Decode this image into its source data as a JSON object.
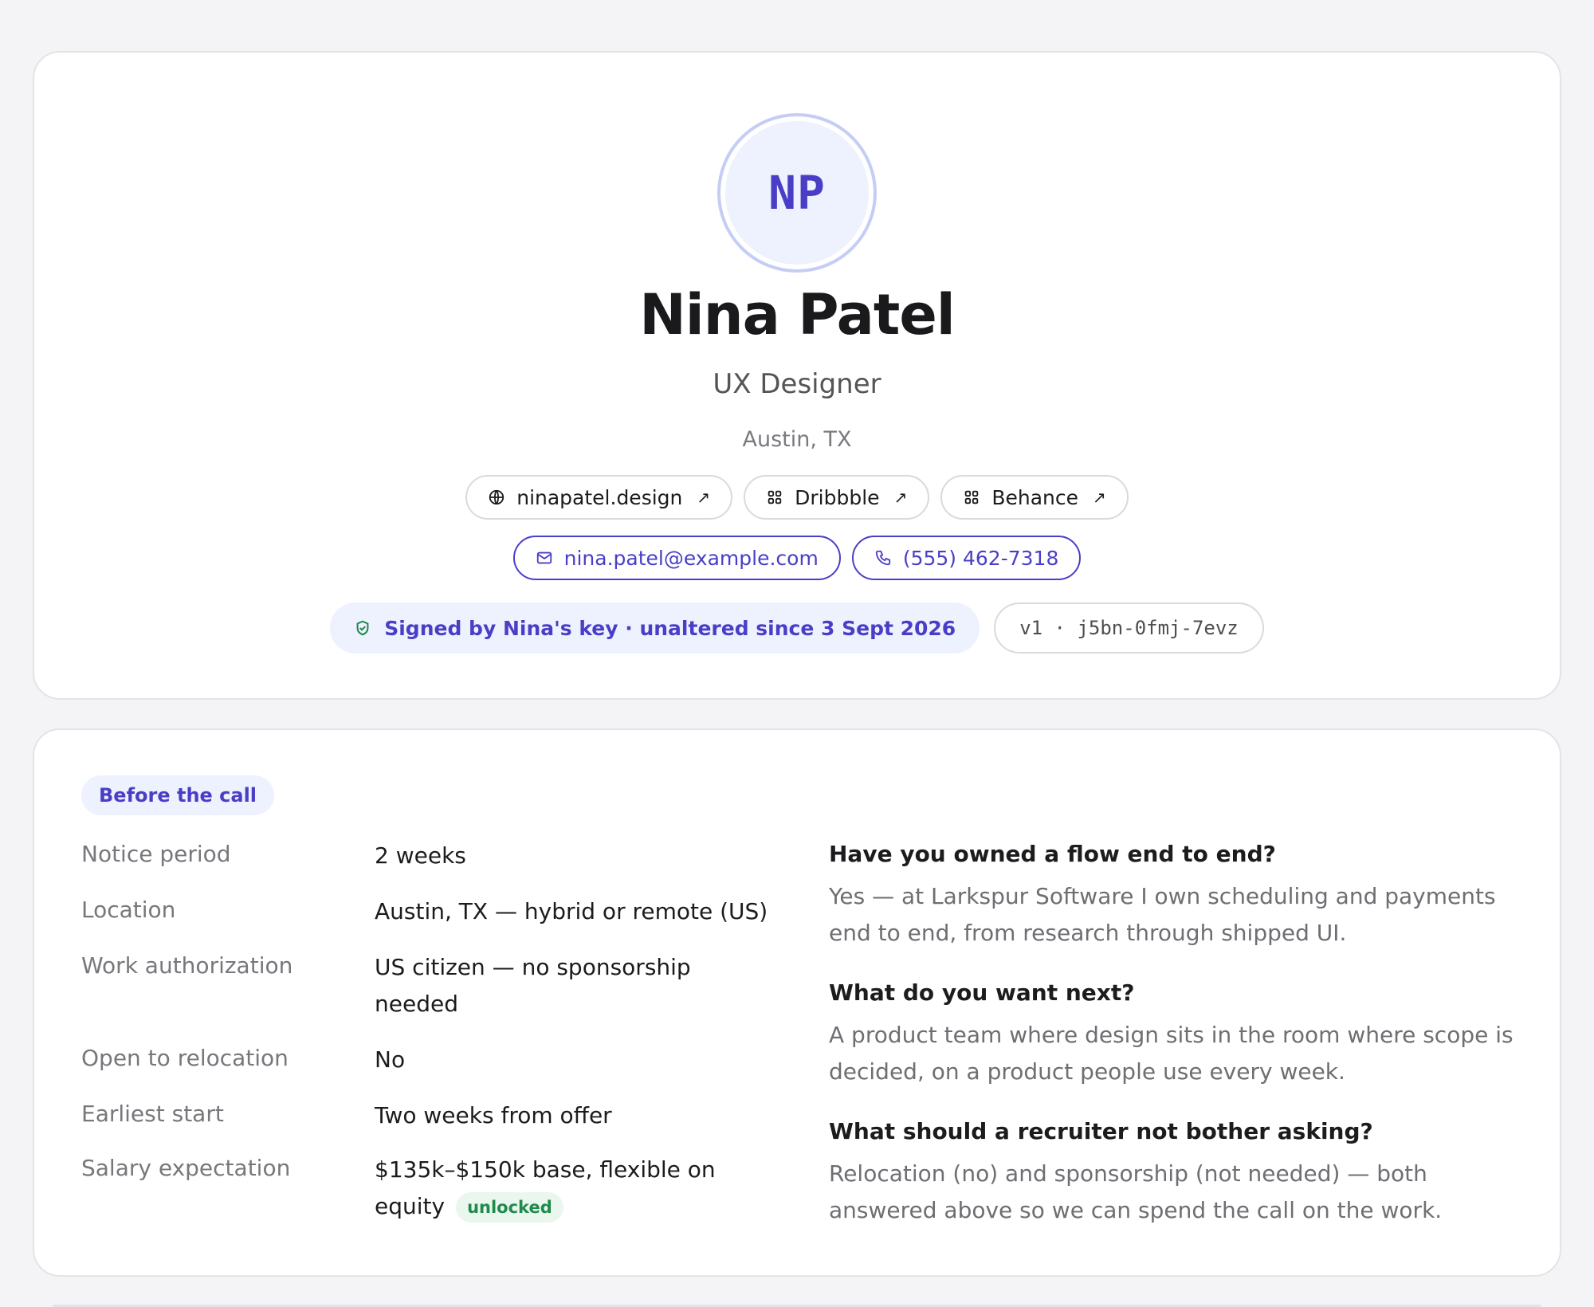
{
  "profile": {
    "initials": "NP",
    "name": "Nina Patel",
    "role": "UX Designer",
    "location": "Austin, TX",
    "links": [
      {
        "label": "ninapatel.design",
        "icon": "globe-icon"
      },
      {
        "label": "Dribbble",
        "icon": "grid-icon"
      },
      {
        "label": "Behance",
        "icon": "grid-icon"
      }
    ],
    "email": "nina.patel@example.com",
    "phone": "(555) 462-7318",
    "signature": "Signed by Nina's key · unaltered since 3 Sept 2026",
    "version": "v1 · j5bn-0fmj-7evz"
  },
  "details": {
    "section_label": "Before the call",
    "facts": [
      {
        "label": "Notice period",
        "value": "2 weeks"
      },
      {
        "label": "Location",
        "value": "Austin, TX — hybrid or remote (US)"
      },
      {
        "label": "Work authorization",
        "value": "US citizen — no sponsorship needed"
      },
      {
        "label": "Open to relocation",
        "value": "No"
      },
      {
        "label": "Earliest start",
        "value": "Two weeks from offer"
      },
      {
        "label": "Salary expectation",
        "value": "$135k–$150k base, flexible on equity",
        "badge": "unlocked"
      }
    ],
    "qa": [
      {
        "q": "Have you owned a flow end to end?",
        "a": "Yes — at Larkspur Software I own scheduling and payments end to end, from research through shipped UI."
      },
      {
        "q": "What do you want next?",
        "a": "A product team where design sits in the room where scope is decided, on a product people use every week."
      },
      {
        "q": "What should a recruiter not bother asking?",
        "a": "Relocation (no) and sponsorship (not needed) — both answered above so we can spend the call on the work."
      }
    ]
  },
  "colors": {
    "accent": "#4a3ec6",
    "accent_bg": "#eef1fe",
    "success": "#1f8a4c",
    "page_bg": "#f4f4f6"
  }
}
